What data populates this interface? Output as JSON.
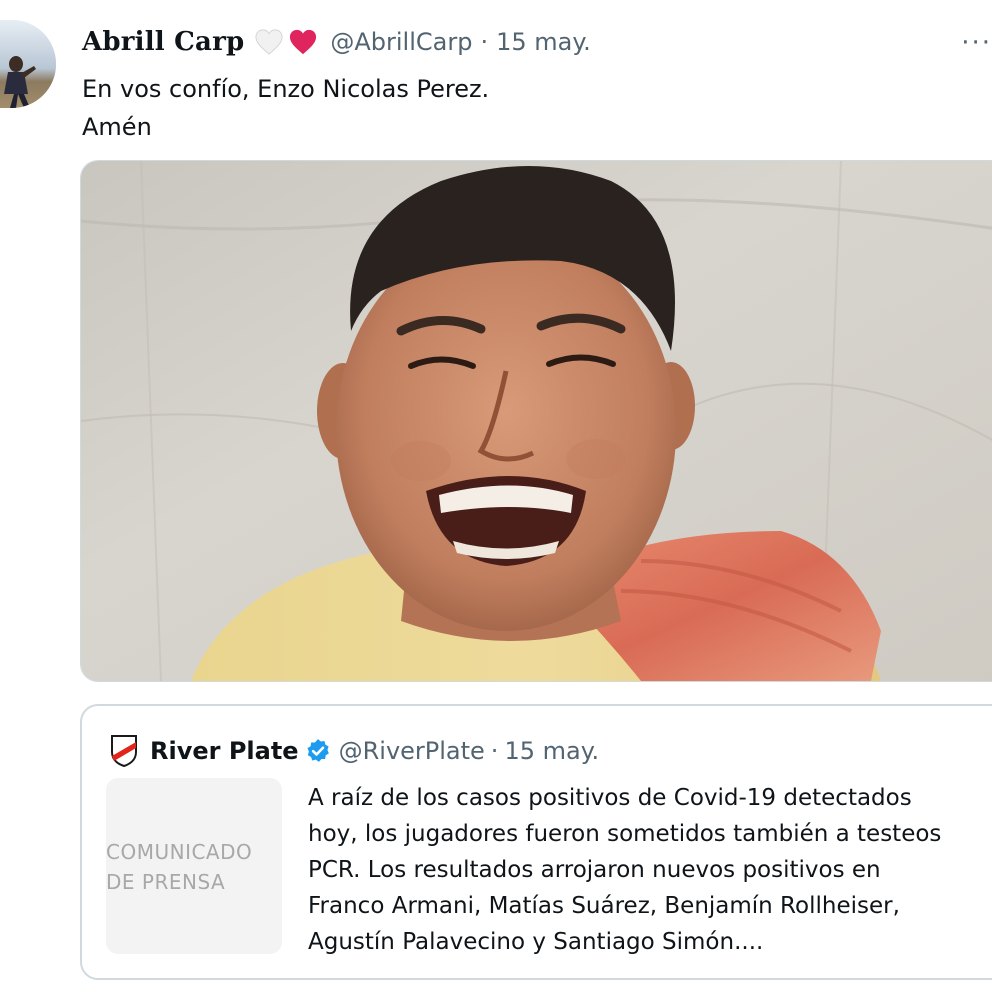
{
  "tweet": {
    "display_name": "Abrill Carp",
    "name_emojis": [
      "white-heart-icon",
      "red-heart-icon"
    ],
    "handle": "@AbrillCarp",
    "separator": "·",
    "date": "15 may.",
    "more_label": "···",
    "text_lines": [
      "En vos confío, Enzo Nicolas Perez.",
      "Amén"
    ]
  },
  "quoted_tweet": {
    "display_name": "River Plate",
    "verified": true,
    "handle": "@RiverPlate",
    "separator": "·",
    "date": "15 may.",
    "thumbnail_lines": [
      "COMUNICADO",
      "DE PRENSA"
    ],
    "text_lines": [
      "A raíz de los casos positivos de Covid-19 detectados",
      "hoy, los jugadores fueron sometidos también a testeos",
      "PCR. Los resultados arrojaron nuevos positivos en",
      "Franco Armani, Matías Suárez, Benjamín Rollheiser,",
      "Agustín Palavecino y Santiago Simón...."
    ]
  },
  "colors": {
    "text_primary": "#0f1419",
    "text_secondary": "#536471",
    "border": "#cfd9de",
    "verified_blue": "#1d9bf0",
    "heart_red": "#e0245e",
    "river_red": "#e1251b"
  }
}
